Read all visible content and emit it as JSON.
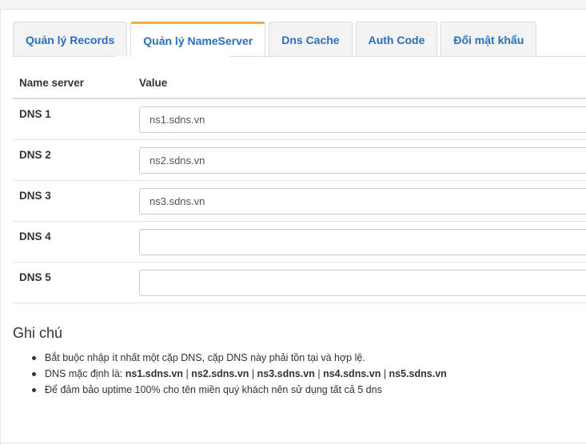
{
  "tabs": [
    {
      "label": "Quản lý Records",
      "active": false
    },
    {
      "label": "Quản lý NameServer",
      "active": true
    },
    {
      "label": "Dns Cache",
      "active": false
    },
    {
      "label": "Auth Code",
      "active": false
    },
    {
      "label": "Đổi mật khẩu",
      "active": false
    }
  ],
  "table": {
    "headers": {
      "name": "Name server",
      "value": "Value"
    },
    "rows": [
      {
        "label": "DNS 1",
        "value": "ns1.sdns.vn"
      },
      {
        "label": "DNS 2",
        "value": "ns2.sdns.vn"
      },
      {
        "label": "DNS 3",
        "value": "ns3.sdns.vn"
      },
      {
        "label": "DNS 4",
        "value": ""
      },
      {
        "label": "DNS 5",
        "value": ""
      }
    ]
  },
  "notes": {
    "title": "Ghi chú",
    "item1": "Bắt buộc nhập ít nhất một cặp DNS, cặp DNS này phải tồn tại và hợp lệ.",
    "item2_prefix": "DNS mặc định là: ",
    "defaults": [
      "ns1.sdns.vn",
      "ns2.sdns.vn",
      "ns3.sdns.vn",
      "ns4.sdns.vn",
      "ns5.sdns.vn"
    ],
    "separator": " | ",
    "item3": "Để đảm bảo uptime 100% cho tên miền quý khách nên sử dụng tất cả 5 dns"
  },
  "colors": {
    "tab_text": "#2a6fb7",
    "active_tab_accent": "#f0ad4e"
  }
}
